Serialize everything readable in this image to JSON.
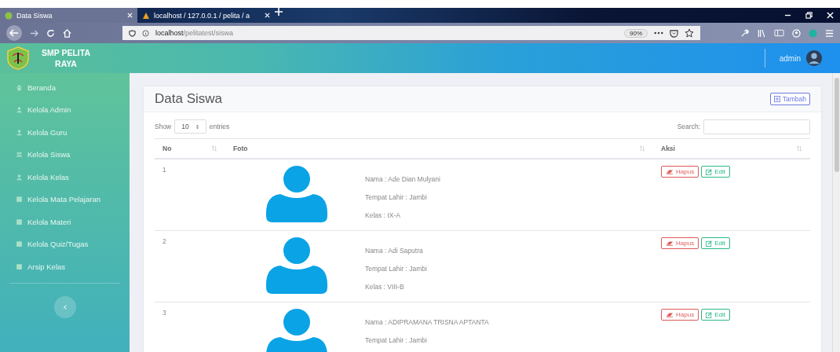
{
  "browser": {
    "tabs": [
      {
        "title": "Data Siswa",
        "selected": true
      },
      {
        "title": "localhost / 127.0.0.1 / pelita / a",
        "selected": false
      }
    ],
    "address": {
      "host": "localhost",
      "path": "/pelitatest/siswa"
    },
    "zoom": "90%"
  },
  "app": {
    "brand": "SMP PELITA RAYA",
    "user": "admin"
  },
  "sidebar": {
    "items": [
      {
        "label": "Beranda",
        "kind": "home"
      },
      {
        "label": "Kelola Admin",
        "kind": "user"
      },
      {
        "label": "Kelola Guru",
        "kind": "user"
      },
      {
        "label": "Kelola Siswa",
        "kind": "users"
      },
      {
        "label": "Kelola Kelas",
        "kind": "user"
      },
      {
        "label": "Kelola Mata Pelajaran",
        "kind": "doc"
      },
      {
        "label": "Kelola Materi",
        "kind": "doc"
      },
      {
        "label": "Kelola Quiz/Tugas",
        "kind": "doc"
      },
      {
        "label": "Arsip Kelas",
        "kind": "doc"
      }
    ]
  },
  "card": {
    "title": "Data Siswa",
    "add_button": "Tambah",
    "show_label": "Show",
    "page_length": "10",
    "entries_label": "entries",
    "search_label": "Search:",
    "columns": [
      "No",
      "Foto",
      "Aksi"
    ],
    "rows": [
      {
        "no": "1",
        "lines": [
          "Nama : Ade Dian Mulyani",
          "Tempat Lahir : Jambi",
          "Kelas : IX-A"
        ],
        "actions": [
          {
            "label": "Hapus",
            "kind": "delete"
          },
          {
            "label": "Edit",
            "kind": "edit"
          }
        ]
      },
      {
        "no": "2",
        "lines": [
          "Nama : Adi Saputra",
          "Tempat Lahir : Jambi",
          "Kelas : VIII-B"
        ],
        "actions": [
          {
            "label": "Hapus",
            "kind": "delete"
          },
          {
            "label": "Edit",
            "kind": "edit"
          }
        ]
      },
      {
        "no": "3",
        "lines": [
          "Nama : ADIPRAMANA TRISNA APTANTA",
          "Tempat Lahir : Jambi"
        ],
        "actions": [
          {
            "label": "Hapus",
            "kind": "delete"
          },
          {
            "label": "Edit",
            "kind": "edit"
          }
        ]
      }
    ]
  }
}
